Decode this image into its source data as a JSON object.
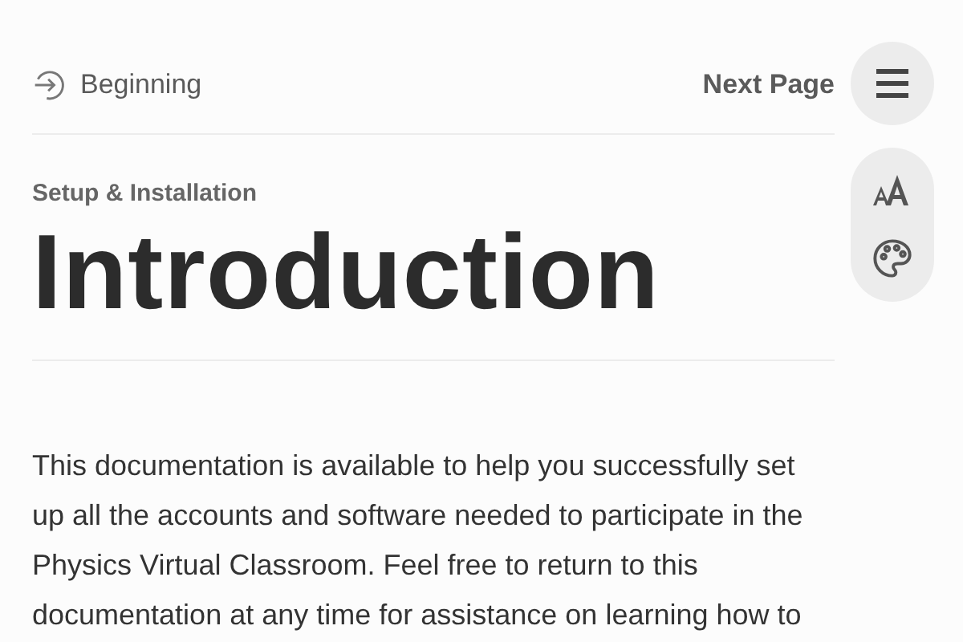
{
  "nav": {
    "back_label": "Beginning",
    "next_label": "Next Page"
  },
  "header": {
    "section": "Setup & Installation",
    "title": "Introduction"
  },
  "body": {
    "paragraph": "This documentation is available to help you successfully set up all the accounts and software needed to participate in the Physics Virtual Classroom. Feel free to return to this documentation at any time for assistance on learning how to"
  }
}
